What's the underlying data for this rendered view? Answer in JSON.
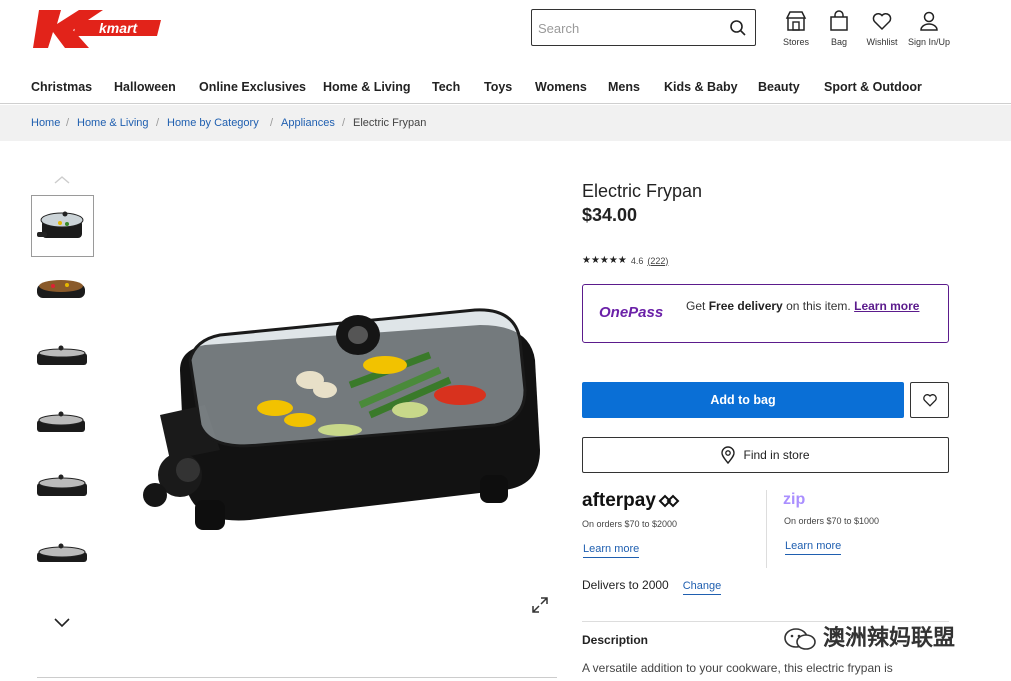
{
  "brand": {
    "logo_text": "kmart",
    "color": "#e2231a"
  },
  "search": {
    "placeholder": "Search"
  },
  "header_icons": [
    {
      "icon": "store-icon",
      "label": "Stores"
    },
    {
      "icon": "bag-icon",
      "label": "Bag"
    },
    {
      "icon": "heart-icon",
      "label": "Wishlist"
    },
    {
      "icon": "user-icon",
      "label": "Sign In/Up"
    }
  ],
  "nav": [
    "Christmas",
    "Halloween",
    "Online Exclusives",
    "Home & Living",
    "Tech",
    "Toys",
    "Womens",
    "Mens",
    "Kids & Baby",
    "Beauty",
    "Sport & Outdoor"
  ],
  "breadcrumb": [
    "Home",
    "Home & Living",
    "Home by Category",
    "Appliances",
    "Electric Frypan"
  ],
  "product": {
    "title": "Electric Frypan",
    "price": "$34.00",
    "rating": "4.6",
    "reviews": "(222)"
  },
  "onepass": {
    "logo": "OnePass",
    "get": "Get ",
    "free": "Free delivery",
    "rest": " on this item. ",
    "learn": "Learn more"
  },
  "actions": {
    "add_to_bag": "Add to bag",
    "find_in_store": "Find in store"
  },
  "afterpay": {
    "logo": "afterpay",
    "range": "On orders $70 to $2000",
    "learn": "Learn more"
  },
  "zip": {
    "logo": "zip",
    "range": "On orders $70 to $1000",
    "learn": "Learn more"
  },
  "delivery": {
    "text": "Delivers to 2000",
    "change": "Change"
  },
  "description": {
    "heading": "Description",
    "text": "A versatile addition to your cookware, this electric frypan is"
  },
  "watermark": "澳洲辣妈联盟",
  "colors": {
    "primary_button": "#0a6fd6",
    "onepass": "#5b1b8c",
    "link": "#1f5fb0"
  }
}
